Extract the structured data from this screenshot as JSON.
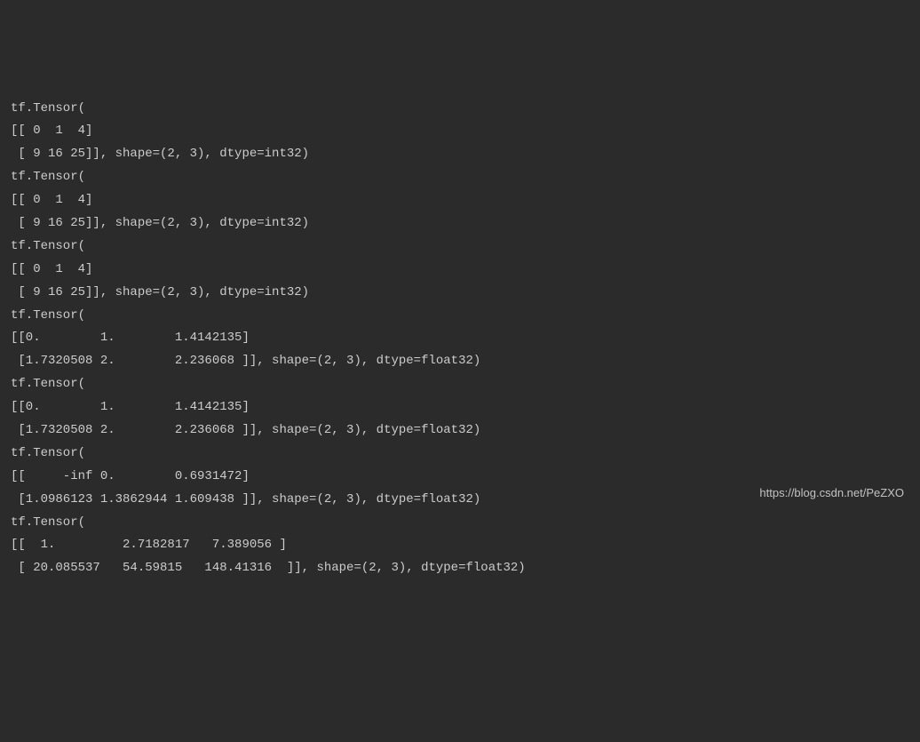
{
  "lines": [
    "tf.Tensor(",
    "[[ 0  1  4]",
    " [ 9 16 25]], shape=(2, 3), dtype=int32)",
    "tf.Tensor(",
    "[[ 0  1  4]",
    " [ 9 16 25]], shape=(2, 3), dtype=int32)",
    "tf.Tensor(",
    "[[ 0  1  4]",
    " [ 9 16 25]], shape=(2, 3), dtype=int32)",
    "tf.Tensor(",
    "[[0.        1.        1.4142135]",
    " [1.7320508 2.        2.236068 ]], shape=(2, 3), dtype=float32)",
    "tf.Tensor(",
    "[[0.        1.        1.4142135]",
    " [1.7320508 2.        2.236068 ]], shape=(2, 3), dtype=float32)",
    "tf.Tensor(",
    "[[     -inf 0.        0.6931472]",
    " [1.0986123 1.3862944 1.609438 ]], shape=(2, 3), dtype=float32)",
    "tf.Tensor(",
    "[[  1.         2.7182817   7.389056 ]",
    " [ 20.085537   54.59815   148.41316  ]], shape=(2, 3), dtype=float32)"
  ],
  "watermark": "https://blog.csdn.net/PeZXO"
}
